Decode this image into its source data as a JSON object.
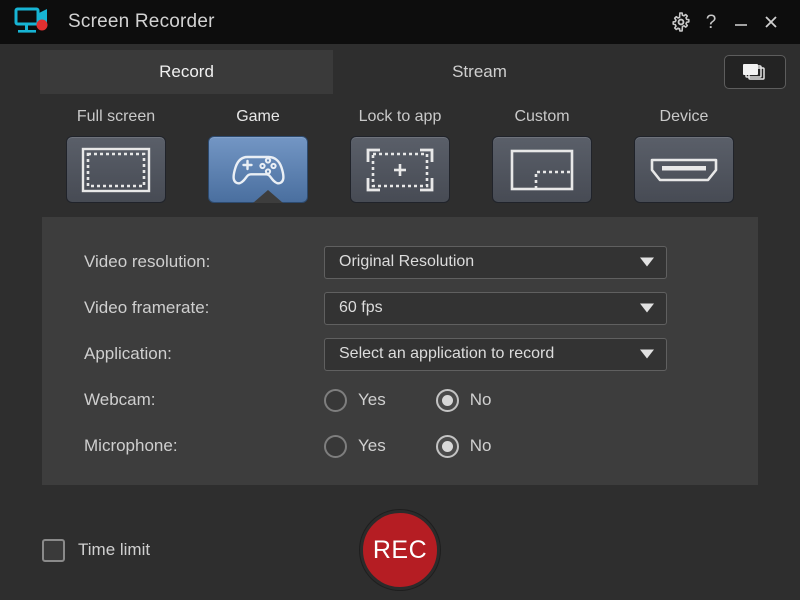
{
  "window": {
    "title": "Screen Recorder",
    "app_icon": "screen-recorder-icon",
    "controls": {
      "settings_label": "⚙",
      "help_label": "?",
      "minimize_label": "—",
      "close_label": "✕"
    }
  },
  "tabs": {
    "items": [
      {
        "label": "Record",
        "active": true
      },
      {
        "label": "Stream",
        "active": false
      }
    ],
    "multi_window_icon": "stacked-windows-icon"
  },
  "modes": {
    "items": [
      {
        "label": "Full screen",
        "icon": "full-screen-icon",
        "selected": false
      },
      {
        "label": "Game",
        "icon": "gamepad-icon",
        "selected": true
      },
      {
        "label": "Lock to app",
        "icon": "lock-to-app-icon",
        "selected": false
      },
      {
        "label": "Custom",
        "icon": "custom-region-icon",
        "selected": false
      },
      {
        "label": "Device",
        "icon": "hdmi-device-icon",
        "selected": false
      }
    ]
  },
  "settings": {
    "video_resolution": {
      "label": "Video resolution:",
      "value": "Original Resolution"
    },
    "video_framerate": {
      "label": "Video framerate:",
      "value": "60 fps"
    },
    "application": {
      "label": "Application:",
      "value": "Select an application to record"
    },
    "webcam": {
      "label": "Webcam:",
      "yes_label": "Yes",
      "no_label": "No",
      "selected": "No"
    },
    "microphone": {
      "label": "Microphone:",
      "yes_label": "Yes",
      "no_label": "No",
      "selected": "No"
    }
  },
  "footer": {
    "time_limit_label": "Time limit",
    "time_limit_checked": false,
    "record_button_label": "REC"
  },
  "colors": {
    "window_background": "#2e2e2e",
    "titlebar_background": "#0d0d0d",
    "panel_background": "#3d3d3d",
    "accent_blue": "#5a82b5",
    "record_red": "#b51d23",
    "logo_cyan": "#17b4d4"
  }
}
